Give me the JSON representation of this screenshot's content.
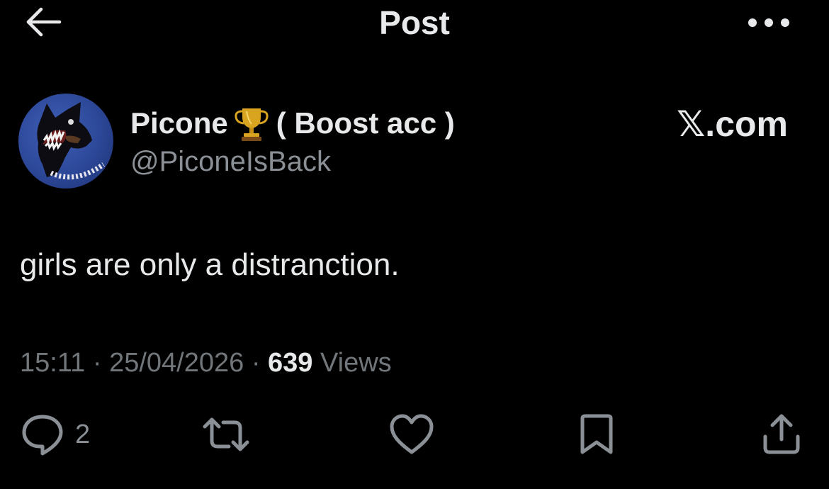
{
  "header": {
    "title": "Post",
    "back_icon": "arrow-left-icon",
    "more_icon": "more-horizontal-icon"
  },
  "author": {
    "display_name": "Picone",
    "badge_emoji_icon": "trophy-icon",
    "name_suffix": "( Boost acc )",
    "handle": "@PiconeIsBack",
    "avatar_icon": "doberman-avatar"
  },
  "watermark": "𝕏.com",
  "post": {
    "text": "girls are only a distranction."
  },
  "meta": {
    "time": "15:11",
    "separator": "·",
    "date": "25/04/2026",
    "views_count": "639",
    "views_label": "Views"
  },
  "actions": {
    "reply_icon": "reply-icon",
    "reply_count": "2",
    "repost_icon": "repost-icon",
    "like_icon": "heart-icon",
    "bookmark_icon": "bookmark-icon",
    "share_icon": "share-icon"
  },
  "colors": {
    "background": "#000000",
    "primary_text": "#e7e9ea",
    "secondary_text": "#71767b",
    "icon": "#8b9096",
    "avatar_bg": "#2c4797",
    "trophy_gold": "#d9a521"
  }
}
